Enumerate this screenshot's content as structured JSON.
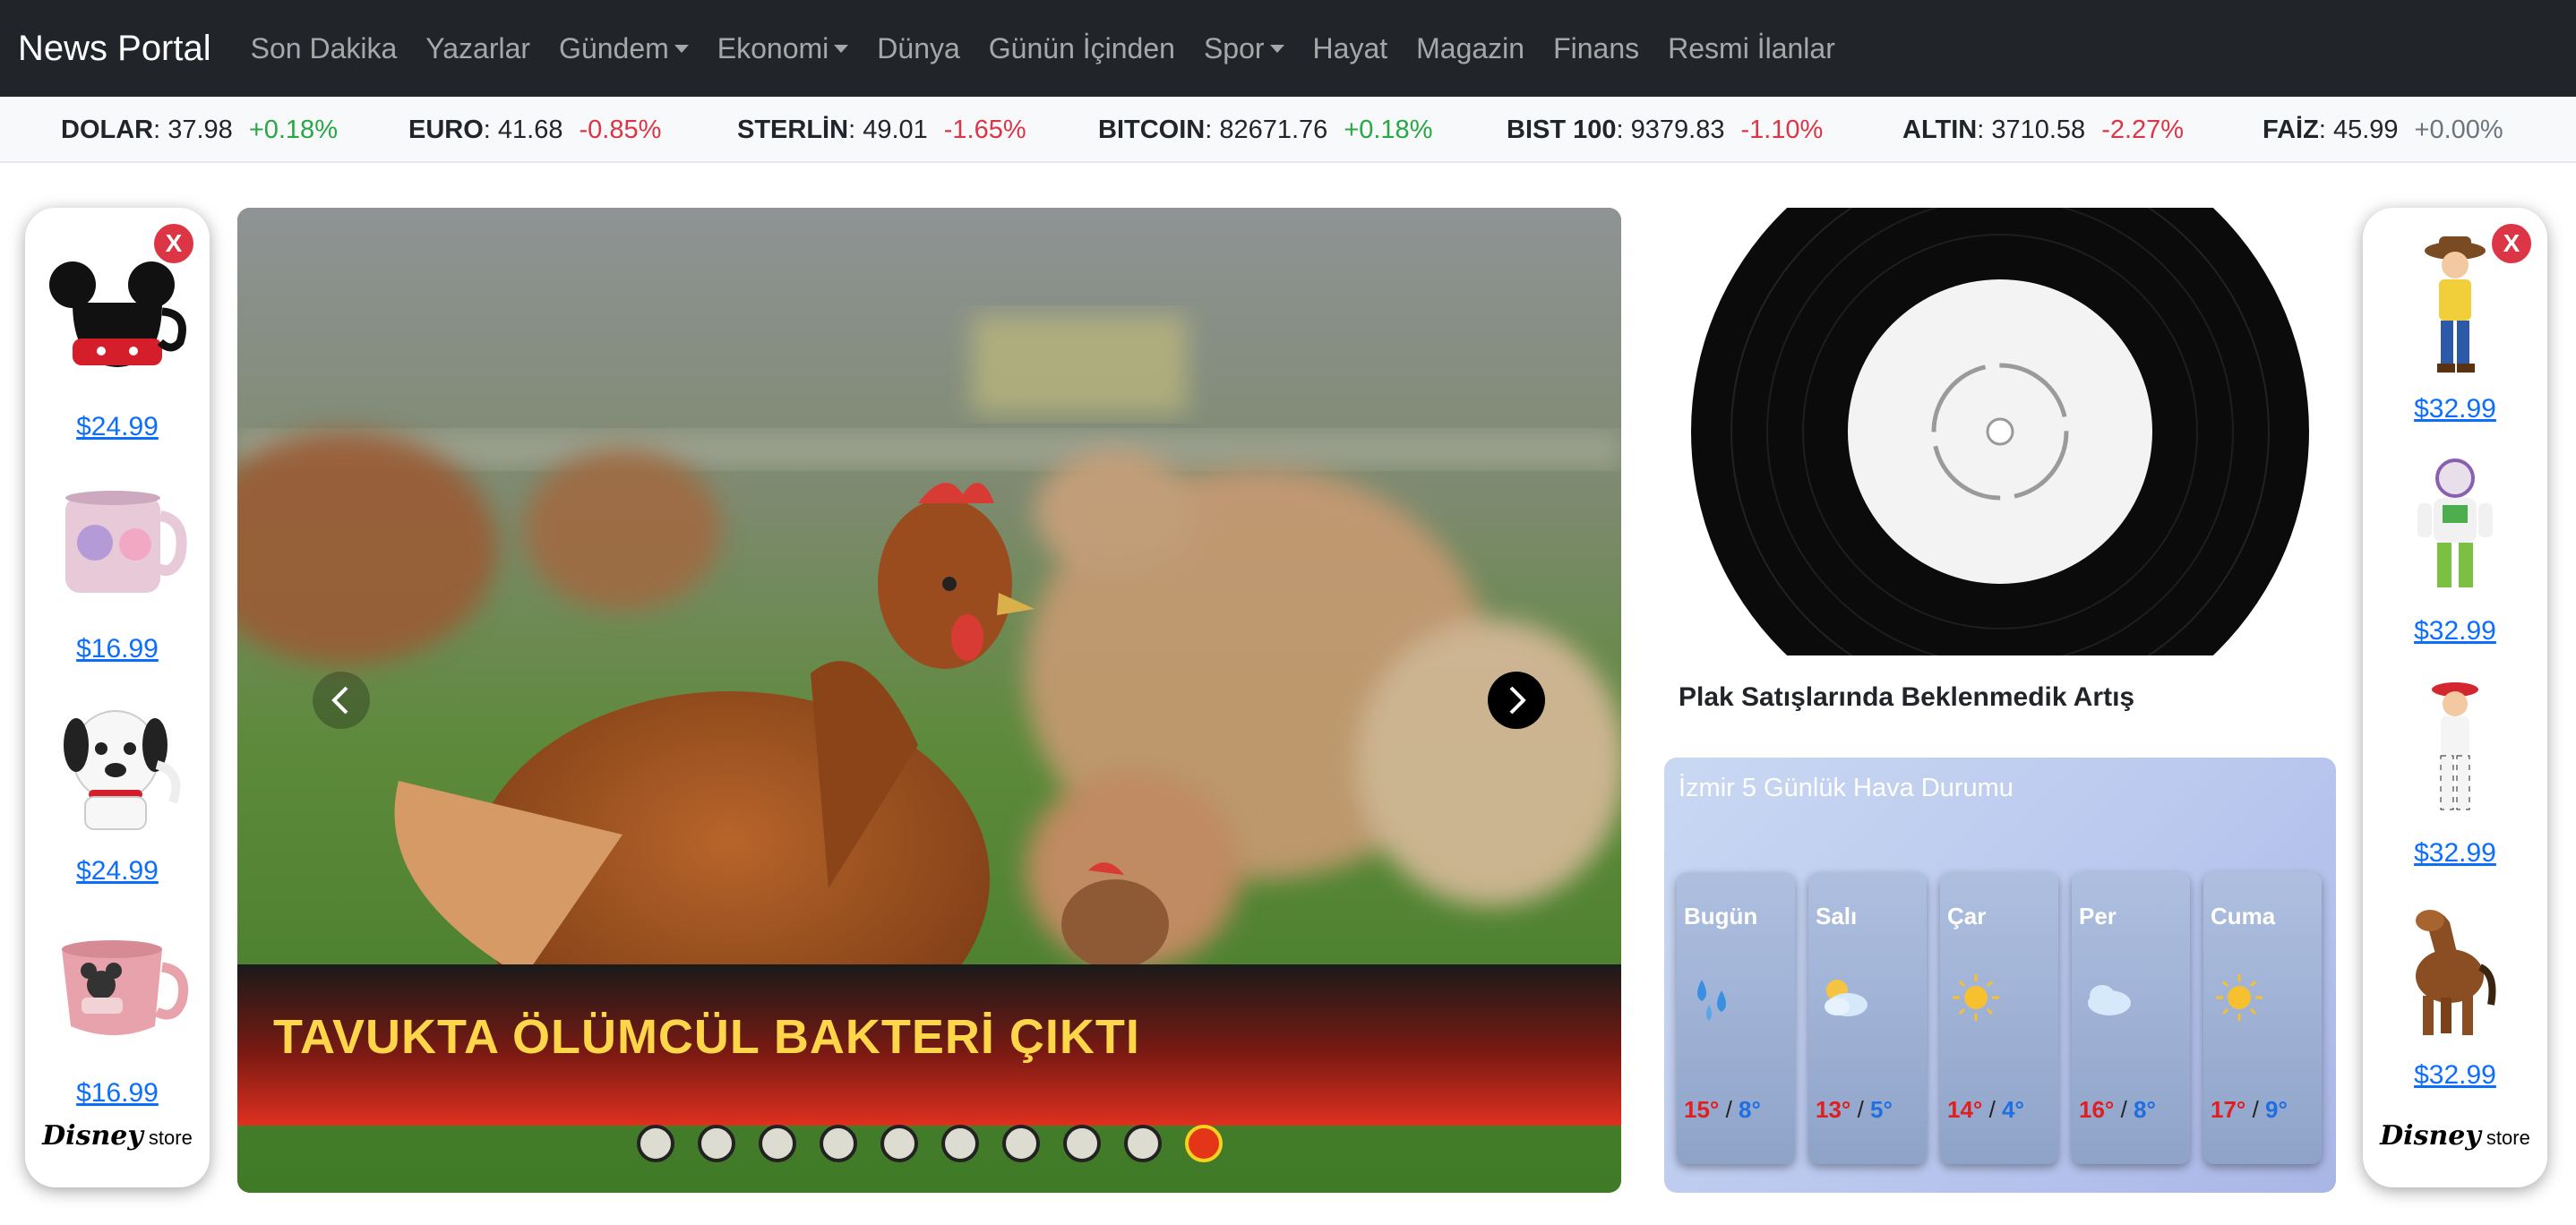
{
  "navbar": {
    "brand": "News Portal",
    "items": [
      {
        "label": "Son Dakika",
        "dropdown": false
      },
      {
        "label": "Yazarlar",
        "dropdown": false
      },
      {
        "label": "Gündem",
        "dropdown": true
      },
      {
        "label": "Ekonomi",
        "dropdown": true
      },
      {
        "label": "Dünya",
        "dropdown": false
      },
      {
        "label": "Günün İçinden",
        "dropdown": false
      },
      {
        "label": "Spor",
        "dropdown": true
      },
      {
        "label": "Hayat",
        "dropdown": false
      },
      {
        "label": "Magazin",
        "dropdown": false
      },
      {
        "label": "Finans",
        "dropdown": false
      },
      {
        "label": "Resmi İlanlar",
        "dropdown": false
      }
    ]
  },
  "ticker": [
    {
      "name": "DOLAR",
      "value": "37.98",
      "change": "+0.18%",
      "trend": "up"
    },
    {
      "name": "EURO",
      "value": "41.68",
      "change": "-0.85%",
      "trend": "down"
    },
    {
      "name": "STERLİN",
      "value": "49.01",
      "change": "-1.65%",
      "trend": "down"
    },
    {
      "name": "BITCOIN",
      "value": "82671.76",
      "change": "+0.18%",
      "trend": "up"
    },
    {
      "name": "BIST 100",
      "value": "9379.83",
      "change": "-1.10%",
      "trend": "down"
    },
    {
      "name": "ALTIN",
      "value": "3710.58",
      "change": "-2.27%",
      "trend": "down"
    },
    {
      "name": "FAİZ",
      "value": "45.99",
      "change": "+0.00%",
      "trend": "flat"
    }
  ],
  "ads": {
    "close_label": "X",
    "brand": {
      "word": "Disney",
      "suffix": "store"
    },
    "left": [
      {
        "product": "mickey-mug-icon",
        "price": "$24.99"
      },
      {
        "product": "pink-mug-icon",
        "price": "$16.99"
      },
      {
        "product": "dalmatian-mug-icon",
        "price": "$24.99"
      },
      {
        "product": "minnie-mug-icon",
        "price": "$16.99"
      }
    ],
    "right": [
      {
        "product": "woody-figure-icon",
        "price": "$32.99"
      },
      {
        "product": "buzz-figure-icon",
        "price": "$32.99"
      },
      {
        "product": "jessie-figure-icon",
        "price": "$32.99"
      },
      {
        "product": "bullseye-figure-icon",
        "price": "$32.99"
      }
    ]
  },
  "carousel": {
    "caption": "TAVUKTA ÖLÜMCÜL BAKTERİ ÇIKTI",
    "slide_count": 10,
    "active_index": 9
  },
  "feature": {
    "title": "Plak Satışlarında Beklenmedik Artış"
  },
  "weather": {
    "title": "İzmir 5 Günlük Hava Durumu",
    "days": [
      {
        "day": "Bugün",
        "icon": "rain-icon",
        "high": "15°",
        "low": "8°"
      },
      {
        "day": "Salı",
        "icon": "cloud-sun-icon",
        "high": "13°",
        "low": "5°"
      },
      {
        "day": "Çar",
        "icon": "sun-icon",
        "high": "14°",
        "low": "4°"
      },
      {
        "day": "Per",
        "icon": "cloud-icon",
        "high": "16°",
        "low": "8°"
      },
      {
        "day": "Cuma",
        "icon": "sun-icon",
        "high": "17°",
        "low": "9°"
      }
    ],
    "separator": "/"
  },
  "colors": {
    "navbar_bg": "#212529",
    "up": "#28a745",
    "down": "#dc3545",
    "caption_text": "#ffd54a",
    "close_button": "#dc3545"
  }
}
